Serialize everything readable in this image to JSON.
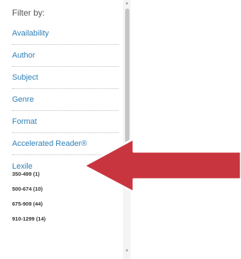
{
  "filter_heading": "Filter by:",
  "facets": [
    {
      "label": "Availability"
    },
    {
      "label": "Author"
    },
    {
      "label": "Subject"
    },
    {
      "label": "Genre"
    },
    {
      "label": "Format"
    },
    {
      "label": "Accelerated Reader®"
    },
    {
      "label": "Lexile"
    }
  ],
  "lexile_options": [
    {
      "label": "350-499 (1)"
    },
    {
      "label": "500-674 (10)"
    },
    {
      "label": "675-909 (44)"
    },
    {
      "label": "910-1299 (14)"
    }
  ],
  "arrow_color": "#c8353f",
  "link_color": "#2f7fb6"
}
